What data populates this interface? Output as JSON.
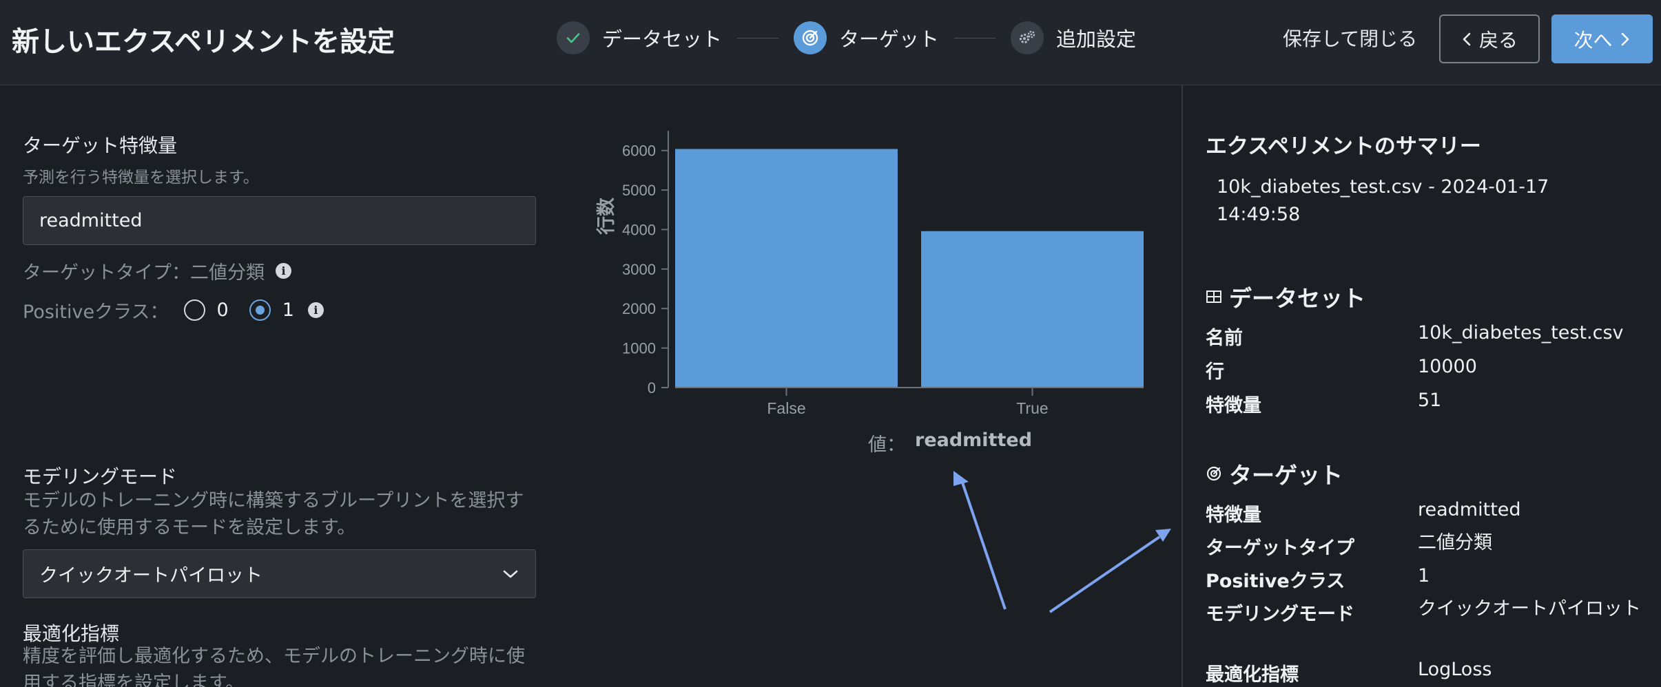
{
  "header": {
    "title": "新しいエクスペリメントを設定",
    "steps": [
      {
        "label": "データセット",
        "state": "done"
      },
      {
        "label": "ターゲット",
        "state": "active"
      },
      {
        "label": "追加設定",
        "state": "pending"
      }
    ],
    "save_close": "保存して閉じる",
    "back": "戻る",
    "next": "次へ"
  },
  "target_feature": {
    "title": "ターゲット特徴量",
    "description": "予測を行う特徴量を選択します。",
    "value": "readmitted",
    "type_label": "ターゲットタイプ：二値分類",
    "positive_class_label": "Positiveクラス：",
    "options": [
      "0",
      "1"
    ],
    "selected": "1"
  },
  "modeling_mode": {
    "title": "モデリングモード",
    "description": "モデルのトレーニング時に構築するブループリントを選択するために使用するモードを設定します。",
    "value": "クイックオートパイロット"
  },
  "optimization": {
    "title": "最適化指標",
    "description": "精度を評価し最適化するため、モデルのトレーニング時に使用する指標を設定します。"
  },
  "chart_data": {
    "type": "bar",
    "categories": [
      "False",
      "True"
    ],
    "values": [
      6040,
      3960
    ],
    "ylabel": "行数",
    "xlabel_prefix": "値：",
    "xlabel_value": "readmitted",
    "ylim": [
      0,
      6500
    ],
    "yticks": [
      0,
      1000,
      2000,
      3000,
      4000,
      5000,
      6000
    ],
    "bar_color": "#5b9bd9",
    "grid": false
  },
  "summary": {
    "title": "エクスペリメントのサマリー",
    "file_line1": "10k_diabetes_test.csv - 2024-01-17",
    "file_line2": "14:49:58",
    "dataset": {
      "heading": "データセット",
      "rows": [
        {
          "key": "名前",
          "value": "10k_diabetes_test.csv"
        },
        {
          "key": "行",
          "value": "10000"
        },
        {
          "key": "特徴量",
          "value": "51"
        }
      ]
    },
    "target": {
      "heading": "ターゲット",
      "rows": [
        {
          "key": "特徴量",
          "value": "readmitted"
        },
        {
          "key": "ターゲットタイプ",
          "value": "二値分類"
        },
        {
          "key": "Positiveクラス",
          "value": "1"
        },
        {
          "key": "モデリングモード",
          "value": "クイックオートパイロット"
        },
        {
          "key": "最適化指標",
          "value": "LogLoss"
        }
      ]
    }
  },
  "colors": {
    "accent": "#5b9bd9",
    "background": "#1b1e23",
    "header": "#22262c",
    "annotation_arrow": "#7ea3f0"
  }
}
